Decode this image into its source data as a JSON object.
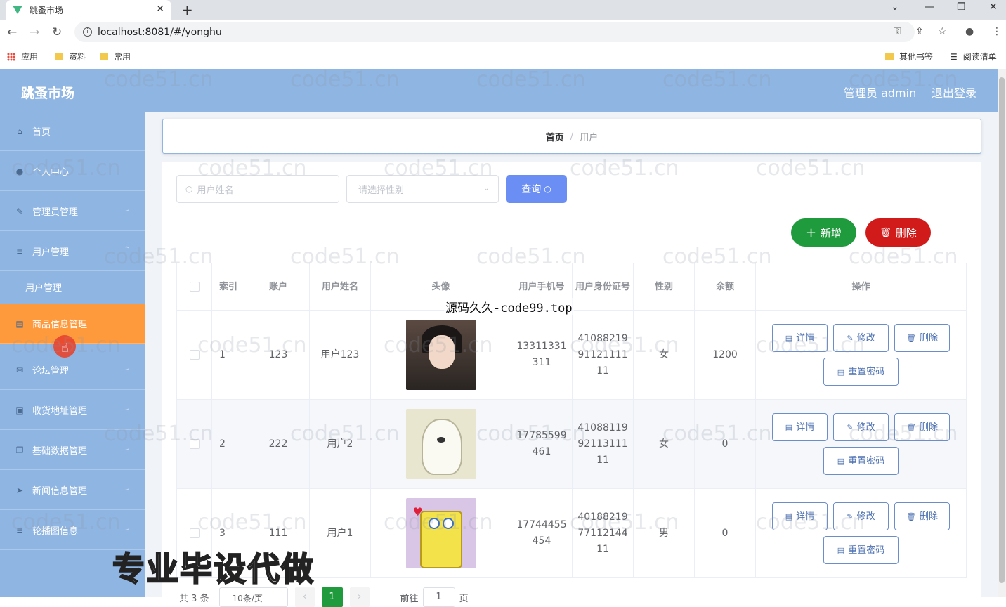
{
  "browser": {
    "tab_title": "跳蚤市场",
    "url": "localhost:8081/#/yonghu",
    "bookmarks": [
      "应用",
      "资料",
      "常用"
    ],
    "bookmarks_right": [
      "其他书签",
      "阅读清单"
    ]
  },
  "header": {
    "logo": "跳蚤市场",
    "admin": "管理员 admin",
    "logout": "退出登录"
  },
  "sidebar": {
    "items": [
      {
        "label": "首页",
        "icon": "home-icon"
      },
      {
        "label": "个人中心",
        "icon": "user-icon"
      },
      {
        "label": "管理员管理",
        "icon": "admin-icon"
      },
      {
        "label": "用户管理",
        "icon": "list-icon"
      },
      {
        "label": "用户管理",
        "icon": ""
      },
      {
        "label": "商品信息管理",
        "icon": "goods-icon"
      },
      {
        "label": "论坛管理",
        "icon": "forum-icon"
      },
      {
        "label": "收货地址管理",
        "icon": "address-icon"
      },
      {
        "label": "基础数据管理",
        "icon": "data-icon"
      },
      {
        "label": "新闻信息管理",
        "icon": "news-icon"
      },
      {
        "label": "轮播图信息",
        "icon": "carousel-icon"
      }
    ],
    "active_color": "#ff9a3c"
  },
  "breadcrumb": {
    "home": "首页",
    "current": "用户"
  },
  "search": {
    "name_placeholder": "用户姓名",
    "gender_placeholder": "请选择性别",
    "query_label": "查询"
  },
  "actions": {
    "add_label": "新增",
    "delete_label": "删除"
  },
  "table": {
    "headers": [
      "索引",
      "账户",
      "用户姓名",
      "头像",
      "用户手机号",
      "用户身份证号",
      "性别",
      "余额",
      "操作"
    ],
    "rows": [
      {
        "index": "1",
        "account": "123",
        "name": "用户123",
        "phone": "13311331311",
        "idcard": "410882199112111111",
        "gender": "女",
        "balance": "1200"
      },
      {
        "index": "2",
        "account": "222",
        "name": "用户2",
        "phone": "17785599461",
        "idcard": "410881199211311111",
        "gender": "女",
        "balance": "0"
      },
      {
        "index": "3",
        "account": "111",
        "name": "用户1",
        "phone": "17744455454",
        "idcard": "401882197711214411",
        "gender": "男",
        "balance": "0"
      }
    ],
    "op_labels": {
      "detail": "详情",
      "edit": "修改",
      "delete": "删除",
      "reset": "重置密码"
    }
  },
  "pager": {
    "total": "共 3 条",
    "size": "10条/页",
    "page": "1",
    "goto": "前往",
    "goto_value": "1",
    "page_suffix": "页"
  },
  "watermark": "code51.cn",
  "overlay_text_1": "源码久久-code99.top",
  "overlay_text_2": "专业毕设代做"
}
